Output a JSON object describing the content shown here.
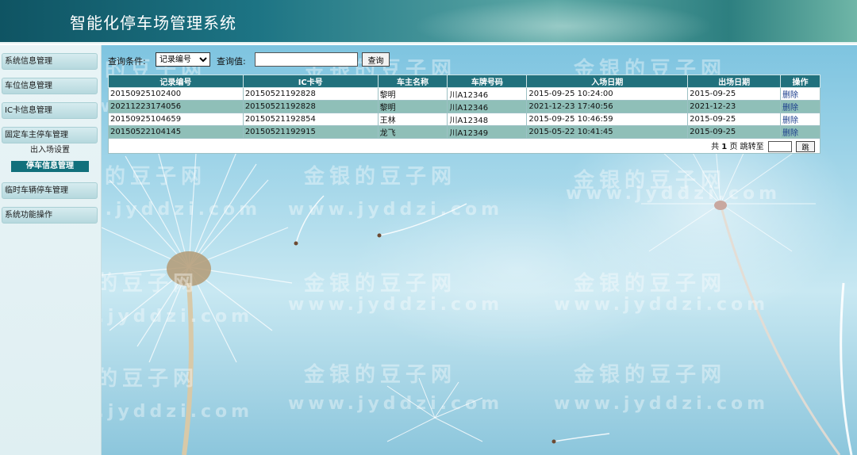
{
  "header": {
    "title": "智能化停车场管理系统"
  },
  "sidebar": {
    "items": [
      {
        "label": "系统信息管理"
      },
      {
        "label": "车位信息管理"
      },
      {
        "label": "IC卡信息管理"
      },
      {
        "label": "固定车主停车管理"
      },
      {
        "label": "临时车辆停车管理"
      },
      {
        "label": "系统功能操作"
      }
    ],
    "sub_items": [
      {
        "label": "出入场设置"
      },
      {
        "label": "停车信息管理"
      }
    ]
  },
  "query": {
    "condition_label": "查询条件:",
    "condition_selected": "记录编号",
    "value_label": "查询值:",
    "value_input": "",
    "search_button": "查询"
  },
  "table": {
    "columns": [
      "记录编号",
      "IC卡号",
      "车主名称",
      "车牌号码",
      "入场日期",
      "出场日期",
      "操作"
    ],
    "rows": [
      [
        "20150925102400",
        "20150521192828",
        "黎明",
        "川A12346",
        "2015-09-25 10:24:00",
        "2015-09-25",
        "删除"
      ],
      [
        "20211223174056",
        "20150521192828",
        "黎明",
        "川A12346",
        "2021-12-23 17:40:56",
        "2021-12-23",
        "删除"
      ],
      [
        "20150925104659",
        "20150521192854",
        "王林",
        "川A12348",
        "2015-09-25 10:46:59",
        "2015-09-25",
        "删除"
      ],
      [
        "20150522104145",
        "20150521192915",
        "龙飞",
        "川A12349",
        "2015-05-22 10:41:45",
        "2015-09-25",
        "删除"
      ]
    ]
  },
  "pager": {
    "prefix": "共",
    "total_pages": "1",
    "suffix": "页 跳转至",
    "goto_value": "",
    "goto_button": "跳"
  },
  "watermark": {
    "cn": "金银的豆子网",
    "en": "www.jyddzi.com"
  }
}
